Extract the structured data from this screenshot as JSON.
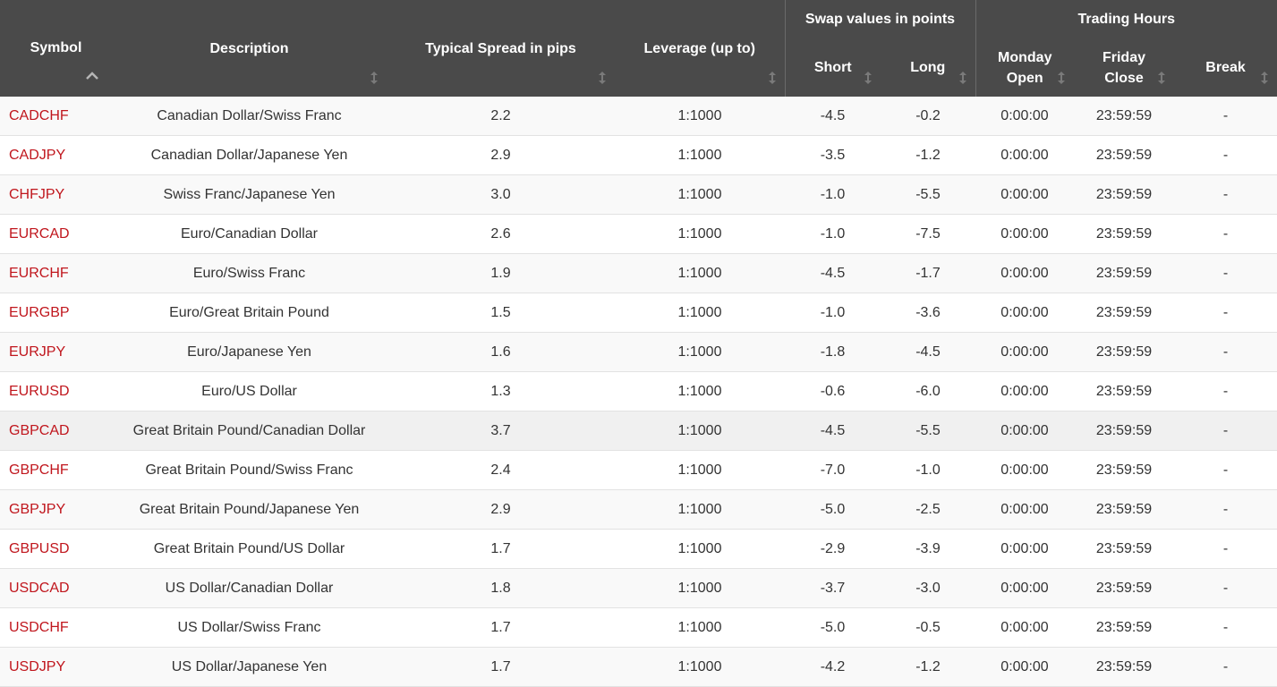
{
  "header": {
    "symbol": "Symbol",
    "description": "Description",
    "spread": "Typical Spread in pips",
    "leverage": "Leverage (up to)",
    "swap_group": "Swap values in points",
    "short": "Short",
    "long": "Long",
    "hours_group": "Trading Hours",
    "monday_open_1": "Monday",
    "monday_open_2": "Open",
    "friday_close_1": "Friday",
    "friday_close_2": "Close",
    "break": "Break"
  },
  "colors": {
    "header_bg": "#4a4a4a",
    "symbol_red": "#c0161d"
  },
  "rows": [
    {
      "symbol": "CADCHF",
      "description": "Canadian Dollar/Swiss Franc",
      "spread": "2.2",
      "leverage": "1:1000",
      "short": "-4.5",
      "long": "-0.2",
      "open": "0:00:00",
      "close": "23:59:59",
      "break": "-"
    },
    {
      "symbol": "CADJPY",
      "description": "Canadian Dollar/Japanese Yen",
      "spread": "2.9",
      "leverage": "1:1000",
      "short": "-3.5",
      "long": "-1.2",
      "open": "0:00:00",
      "close": "23:59:59",
      "break": "-"
    },
    {
      "symbol": "CHFJPY",
      "description": "Swiss Franc/Japanese Yen",
      "spread": "3.0",
      "leverage": "1:1000",
      "short": "-1.0",
      "long": "-5.5",
      "open": "0:00:00",
      "close": "23:59:59",
      "break": "-"
    },
    {
      "symbol": "EURCAD",
      "description": "Euro/Canadian Dollar",
      "spread": "2.6",
      "leverage": "1:1000",
      "short": "-1.0",
      "long": "-7.5",
      "open": "0:00:00",
      "close": "23:59:59",
      "break": "-"
    },
    {
      "symbol": "EURCHF",
      "description": "Euro/Swiss Franc",
      "spread": "1.9",
      "leverage": "1:1000",
      "short": "-4.5",
      "long": "-1.7",
      "open": "0:00:00",
      "close": "23:59:59",
      "break": "-"
    },
    {
      "symbol": "EURGBP",
      "description": "Euro/Great Britain Pound",
      "spread": "1.5",
      "leverage": "1:1000",
      "short": "-1.0",
      "long": "-3.6",
      "open": "0:00:00",
      "close": "23:59:59",
      "break": "-"
    },
    {
      "symbol": "EURJPY",
      "description": "Euro/Japanese Yen",
      "spread": "1.6",
      "leverage": "1:1000",
      "short": "-1.8",
      "long": "-4.5",
      "open": "0:00:00",
      "close": "23:59:59",
      "break": "-"
    },
    {
      "symbol": "EURUSD",
      "description": "Euro/US Dollar",
      "spread": "1.3",
      "leverage": "1:1000",
      "short": "-0.6",
      "long": "-6.0",
      "open": "0:00:00",
      "close": "23:59:59",
      "break": "-"
    },
    {
      "symbol": "GBPCAD",
      "description": "Great Britain Pound/Canadian Dollar",
      "spread": "3.7",
      "leverage": "1:1000",
      "short": "-4.5",
      "long": "-5.5",
      "open": "0:00:00",
      "close": "23:59:59",
      "break": "-"
    },
    {
      "symbol": "GBPCHF",
      "description": "Great Britain Pound/Swiss Franc",
      "spread": "2.4",
      "leverage": "1:1000",
      "short": "-7.0",
      "long": "-1.0",
      "open": "0:00:00",
      "close": "23:59:59",
      "break": "-"
    },
    {
      "symbol": "GBPJPY",
      "description": "Great Britain Pound/Japanese Yen",
      "spread": "2.9",
      "leverage": "1:1000",
      "short": "-5.0",
      "long": "-2.5",
      "open": "0:00:00",
      "close": "23:59:59",
      "break": "-"
    },
    {
      "symbol": "GBPUSD",
      "description": "Great Britain Pound/US Dollar",
      "spread": "1.7",
      "leverage": "1:1000",
      "short": "-2.9",
      "long": "-3.9",
      "open": "0:00:00",
      "close": "23:59:59",
      "break": "-"
    },
    {
      "symbol": "USDCAD",
      "description": "US Dollar/Canadian Dollar",
      "spread": "1.8",
      "leverage": "1:1000",
      "short": "-3.7",
      "long": "-3.0",
      "open": "0:00:00",
      "close": "23:59:59",
      "break": "-"
    },
    {
      "symbol": "USDCHF",
      "description": "US Dollar/Swiss Franc",
      "spread": "1.7",
      "leverage": "1:1000",
      "short": "-5.0",
      "long": "-0.5",
      "open": "0:00:00",
      "close": "23:59:59",
      "break": "-"
    },
    {
      "symbol": "USDJPY",
      "description": "US Dollar/Japanese Yen",
      "spread": "1.7",
      "leverage": "1:1000",
      "short": "-4.2",
      "long": "-1.2",
      "open": "0:00:00",
      "close": "23:59:59",
      "break": "-"
    }
  ]
}
